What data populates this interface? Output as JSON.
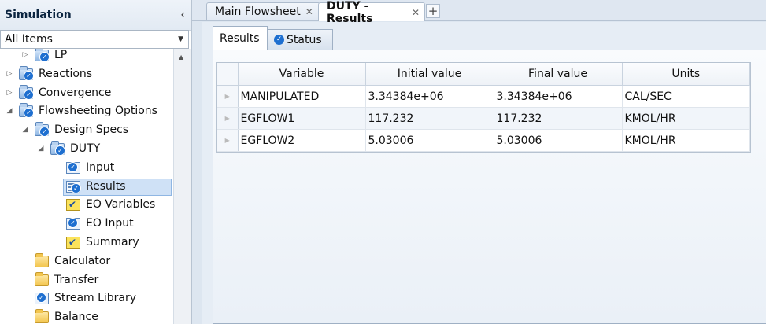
{
  "nav": {
    "title": "Simulation",
    "collapse_icon": "chevron-left-icon",
    "filter": {
      "value": "All Items"
    },
    "tree": [
      {
        "id": "lp",
        "label": "LP",
        "indent": 1,
        "expander": "collapsed",
        "icon": "folder-check"
      },
      {
        "id": "reactions",
        "label": "Reactions",
        "indent": 0,
        "expander": "collapsed",
        "icon": "folder-check"
      },
      {
        "id": "convergence",
        "label": "Convergence",
        "indent": 0,
        "expander": "collapsed",
        "icon": "folder-check"
      },
      {
        "id": "flowsheeting-options",
        "label": "Flowsheeting Options",
        "indent": 0,
        "expander": "expanded",
        "icon": "folder-check"
      },
      {
        "id": "design-specs",
        "label": "Design Specs",
        "indent": 1,
        "expander": "expanded",
        "icon": "folder-check"
      },
      {
        "id": "duty",
        "label": "DUTY",
        "indent": 2,
        "expander": "expanded",
        "icon": "folder-check"
      },
      {
        "id": "input",
        "label": "Input",
        "indent": 3,
        "expander": "none",
        "icon": "form-check"
      },
      {
        "id": "results",
        "label": "Results",
        "indent": 3,
        "expander": "none",
        "icon": "results-check",
        "selected": true
      },
      {
        "id": "eo-variables",
        "label": "EO Variables",
        "indent": 3,
        "expander": "none",
        "icon": "shield-check"
      },
      {
        "id": "eo-input",
        "label": "EO Input",
        "indent": 3,
        "expander": "none",
        "icon": "form-check"
      },
      {
        "id": "summary",
        "label": "Summary",
        "indent": 3,
        "expander": "none",
        "icon": "shield-check"
      },
      {
        "id": "calculator",
        "label": "Calculator",
        "indent": 1,
        "expander": "none",
        "icon": "folder"
      },
      {
        "id": "transfer",
        "label": "Transfer",
        "indent": 1,
        "expander": "none",
        "icon": "folder"
      },
      {
        "id": "stream-library",
        "label": "Stream Library",
        "indent": 1,
        "expander": "none",
        "icon": "form-check"
      },
      {
        "id": "balance",
        "label": "Balance",
        "indent": 1,
        "expander": "none",
        "icon": "folder"
      }
    ]
  },
  "doc_tabs": [
    {
      "label": "Main Flowsheet",
      "active": false
    },
    {
      "label": "DUTY - Results",
      "active": true
    }
  ],
  "sub_tabs": [
    {
      "label": "Results",
      "active": true
    },
    {
      "label": "Status",
      "active": false,
      "icon": "status-check-icon"
    }
  ],
  "grid": {
    "columns": [
      "Variable",
      "Initial value",
      "Final value",
      "Units"
    ],
    "rows": [
      [
        "MANIPULATED",
        "3.34384e+06",
        "3.34384e+06",
        "CAL/SEC"
      ],
      [
        "EGFLOW1",
        "117.232",
        "117.232",
        "KMOL/HR"
      ],
      [
        "EGFLOW2",
        "5.03006",
        "5.03006",
        "KMOL/HR"
      ]
    ]
  },
  "colors": {
    "accent": "#1e6fd0",
    "selection": "#cfe1f6",
    "folder": "#f3c64f"
  }
}
